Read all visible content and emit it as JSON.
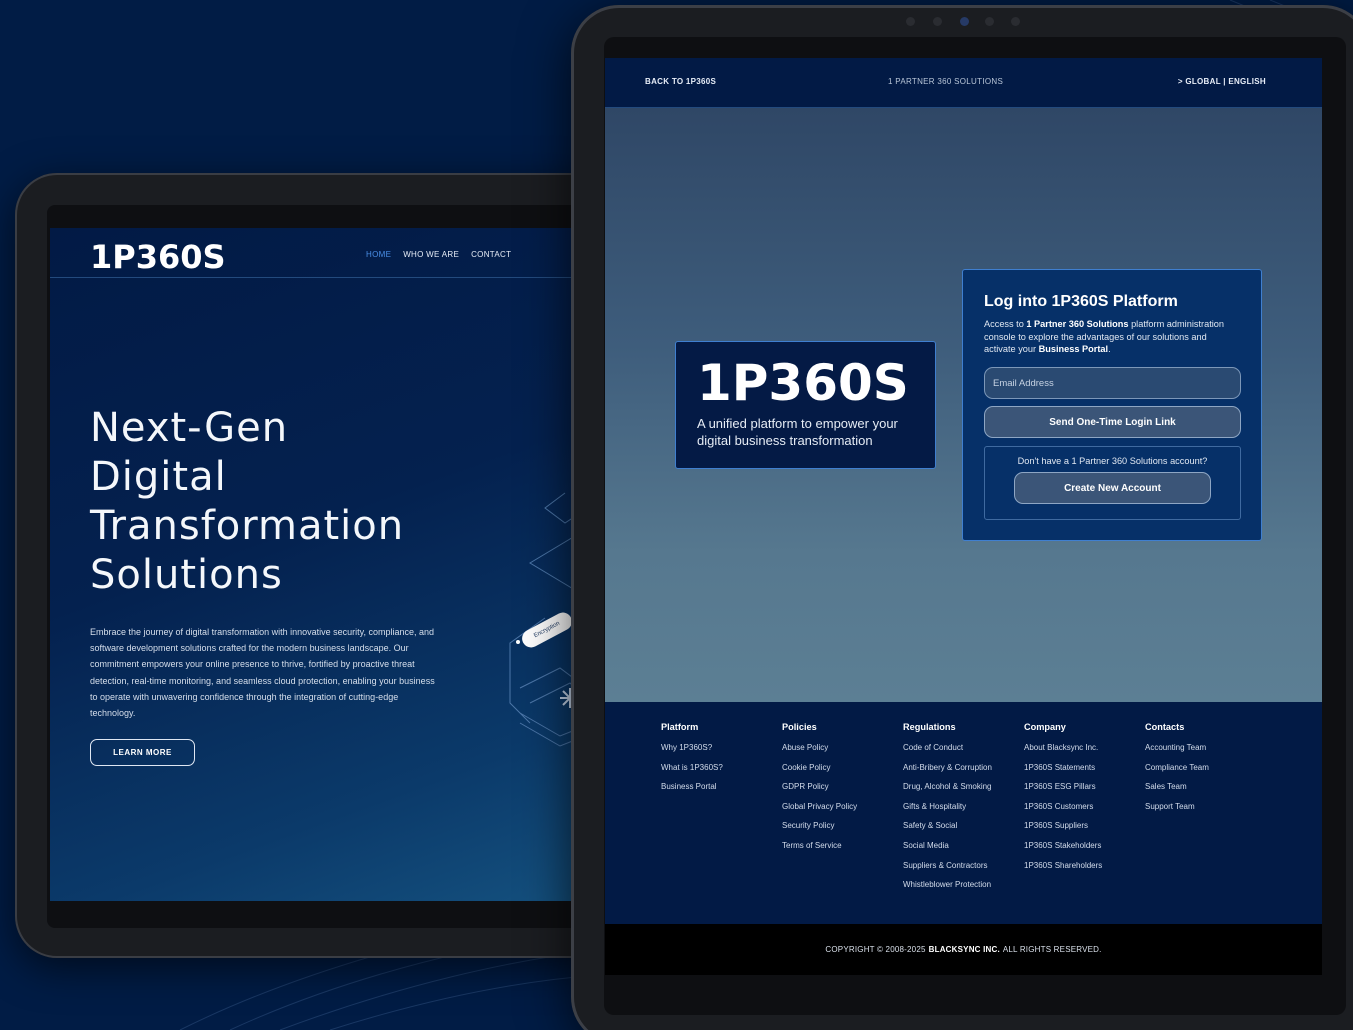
{
  "left_site": {
    "logo": "1P360S",
    "nav": [
      "HOME",
      "WHO WE ARE",
      "CONTACT"
    ],
    "hero_title_lines": [
      "Next-Gen",
      "Digital",
      "Transformation",
      "Solutions"
    ],
    "hero_body": "Embrace the journey of digital transformation with innovative security, compliance, and software development solutions crafted for the modern business landscape. Our commitment empowers your online presence to thrive, fortified by proactive threat detection, real-time monitoring, and seamless cloud protection, enabling your business to operate with unwavering confidence through the integration of cutting-edge technology.",
    "cta": "LEARN MORE",
    "graphic_label": "Encryption"
  },
  "right_site": {
    "topbar": {
      "back": "BACK TO 1P360S",
      "center": "1 PARTNER 360 SOLUTIONS",
      "lang": "> GLOBAL | ENGLISH"
    },
    "brand": {
      "logo": "1P360S",
      "tagline": "A unified platform to empower your digital business transformation"
    },
    "login": {
      "title": "Log into 1P360S Platform",
      "desc_pre": "Access to ",
      "desc_b1": "1 Partner 360 Solutions",
      "desc_mid": " platform administration console to explore the advantages of our solutions and activate your ",
      "desc_b2": "Business Portal",
      "desc_post": ".",
      "email_placeholder": "Email Address",
      "send_label": "Send One-Time Login Link",
      "signup_prompt": "Don't have a 1 Partner 360 Solutions account?",
      "create_label": "Create New Account"
    },
    "footer": {
      "columns": [
        {
          "heading": "Platform",
          "items": [
            "Why 1P360S?",
            "What is 1P360S?",
            "Business Portal"
          ]
        },
        {
          "heading": "Policies",
          "items": [
            "Abuse Policy",
            "Cookie Policy",
            "GDPR Policy",
            "Global Privacy Policy",
            "Security Policy",
            "Terms of Service"
          ]
        },
        {
          "heading": "Regulations",
          "items": [
            "Code of Conduct",
            "Anti-Bribery & Corruption",
            "Drug, Alcohol & Smoking",
            "Gifts & Hospitality",
            "Safety & Social",
            "Social Media",
            "Suppliers & Contractors",
            "Whistleblower Protection"
          ]
        },
        {
          "heading": "Company",
          "items": [
            "About Blacksync Inc.",
            "1P360S Statements",
            "1P360S ESG Pillars",
            "1P360S Customers",
            "1P360S Suppliers",
            "1P360S Stakeholders",
            "1P360S Shareholders"
          ]
        },
        {
          "heading": "Contacts",
          "items": [
            "Accounting Team",
            "Compliance Team",
            "Sales Team",
            "Support Team"
          ]
        }
      ],
      "copyright_pre": "COPYRIGHT © 2008-2025",
      "copyright_company": "BLACKSYNC INC.",
      "copyright_post": "ALL RIGHTS RESERVED."
    }
  },
  "colors": {
    "page_bg": "#011c45",
    "nav_active": "#4a8ee6",
    "card_border": "#3f7fd0",
    "footer_bg": "#021a45",
    "copyright_bg": "#000000"
  }
}
